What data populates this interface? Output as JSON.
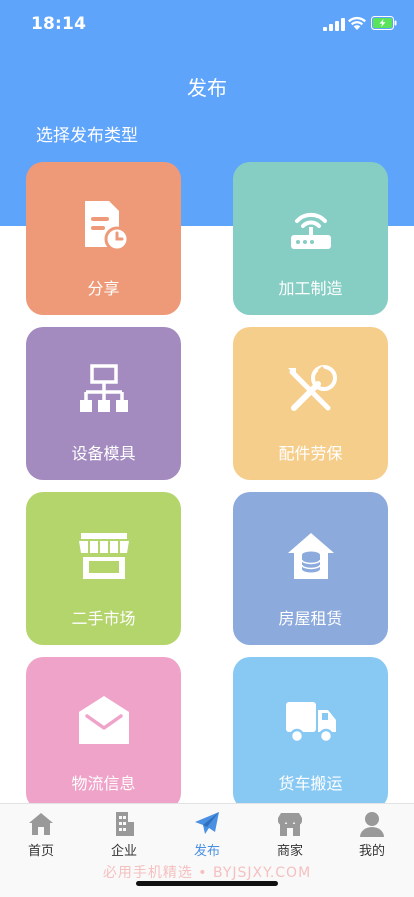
{
  "status_bar": {
    "time": "18:14",
    "icons": [
      "signal-icon",
      "wifi-icon",
      "battery-charging-icon"
    ]
  },
  "header": {
    "title": "发布",
    "section_label": "选择发布类型",
    "background_color": "#5fa4fb"
  },
  "categories": [
    {
      "label": "分享",
      "icon": "document-clock-icon",
      "color": "#ee9a78"
    },
    {
      "label": "加工制造",
      "icon": "router-icon",
      "color": "#86cdc4"
    },
    {
      "label": "设备模具",
      "icon": "hierarchy-icon",
      "color": "#a48bbf"
    },
    {
      "label": "配件劳保",
      "icon": "wrench-screwdriver-icon",
      "color": "#f6ce8c"
    },
    {
      "label": "二手市场",
      "icon": "storefront-icon",
      "color": "#b4d46c"
    },
    {
      "label": "房屋租赁",
      "icon": "house-coins-icon",
      "color": "#8daadd"
    },
    {
      "label": "物流信息",
      "icon": "envelope-icon",
      "color": "#efa3c8"
    },
    {
      "label": "货车搬运",
      "icon": "truck-icon",
      "color": "#88c9f4"
    }
  ],
  "tabbar": {
    "items": [
      {
        "label": "首页",
        "icon": "home-icon",
        "active": false
      },
      {
        "label": "企业",
        "icon": "building-icon",
        "active": false
      },
      {
        "label": "发布",
        "icon": "paper-plane-icon",
        "active": true
      },
      {
        "label": "商家",
        "icon": "shop-icon",
        "active": false
      },
      {
        "label": "我的",
        "icon": "user-icon",
        "active": false
      }
    ],
    "active_color": "#4a90e2",
    "inactive_color": "#333333"
  },
  "watermark": "必用手机精选 • BYJSJXY.COM"
}
